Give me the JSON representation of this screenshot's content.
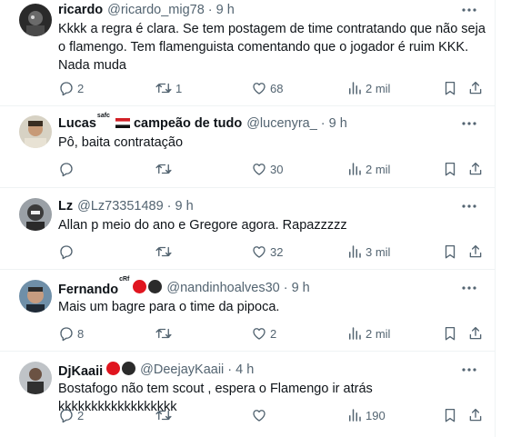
{
  "tweets": [
    {
      "name": "ricardo",
      "handle": "@ricardo_mig78",
      "time": "9 h",
      "text": "Kkkk a regra é clara. Se tem postagem de time contratando que não seja o flamengo. Tem flamenguista comentando que o jogador é ruim KKK. Nada muda",
      "replies": "2",
      "retweets": "1",
      "likes": "68",
      "views": "2 mil"
    },
    {
      "name": "Lucas",
      "name_sup": "safc",
      "name_suffix": "campeão de tudo",
      "handle": "@lucenyra_",
      "time": "9 h",
      "text": "Pô, baita contratação",
      "replies": "",
      "retweets": "",
      "likes": "30",
      "views": "2 mil"
    },
    {
      "name": "Lz",
      "handle": "@Lz73351489",
      "time": "9 h",
      "text": "Allan p meio do ano e Gregore agora. Rapazzzzz",
      "replies": "",
      "retweets": "",
      "likes": "32",
      "views": "3 mil"
    },
    {
      "name": "Fernando",
      "name_sup": "cRf",
      "handle": "@nandinhoalves30",
      "time": "9 h",
      "text": "Mais um bagre para o time da pipoca.",
      "replies": "8",
      "retweets": "",
      "likes": "2",
      "views": "2 mil"
    },
    {
      "name": "DjKaaii",
      "handle": "@DeejayKaaii",
      "time": "4 h",
      "text": "Bostafogo não tem scout , espera o Flamengo ir atrás kkkkkkkkkkkkkkkkkk",
      "replies": "2",
      "retweets": "",
      "likes": "",
      "views": "190"
    }
  ],
  "separator": "·",
  "colors": {
    "text": "#0f1419",
    "secondary": "#536471",
    "border": "#eff3f4",
    "badge_red": "#e0151f",
    "badge_black": "#2b2b2b"
  },
  "icons": [
    "more-icon",
    "reply-icon",
    "retweet-icon",
    "like-icon",
    "views-icon",
    "bookmark-icon",
    "share-icon",
    "flag-icon"
  ]
}
